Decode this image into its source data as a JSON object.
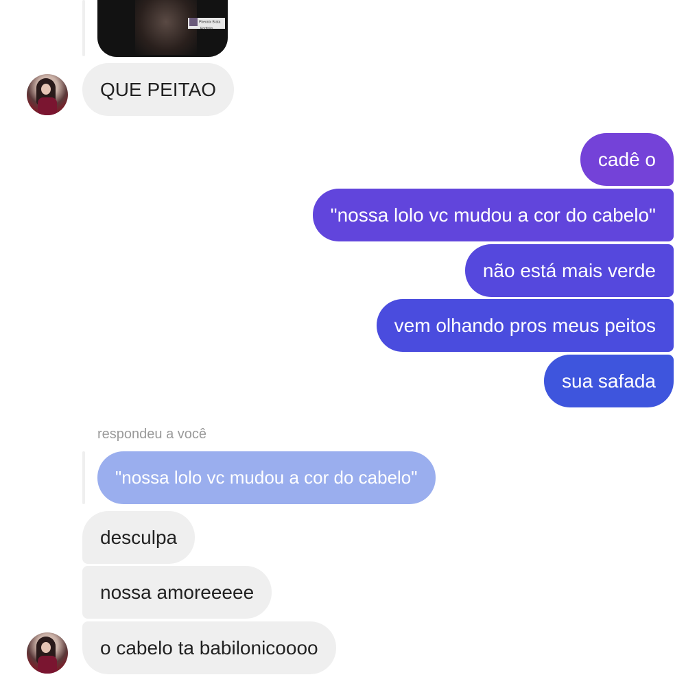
{
  "incoming_top": {
    "image_caption": "Pheonix Brata",
    "image_subcaption": "Portfolio",
    "message": "QUE PEITAO"
  },
  "outgoing": [
    {
      "text": "cadê o",
      "color": "#7442d8"
    },
    {
      "text": "\"nossa lolo vc mudou a cor do cabelo\"",
      "color": "#6145dc"
    },
    {
      "text": "não está mais verde",
      "color": "#5548dd"
    },
    {
      "text": "vem olhando pros meus peitos",
      "color": "#4a4cde"
    },
    {
      "text": "sua safada",
      "color": "#3e55dd"
    }
  ],
  "reply": {
    "label": "respondeu a você",
    "quoted_text": "\"nossa lolo vc mudou a cor do cabelo\"",
    "quoted_color": "#9aaeee"
  },
  "incoming_bottom": [
    {
      "text": "desculpa"
    },
    {
      "text": "nossa amoreeeee"
    },
    {
      "text": "o cabelo ta babilonicoooo"
    }
  ],
  "colors": {
    "incoming_bubble": "#efefef",
    "incoming_text": "#222222",
    "background": "#ffffff"
  },
  "icons": [
    "contact-avatar"
  ]
}
